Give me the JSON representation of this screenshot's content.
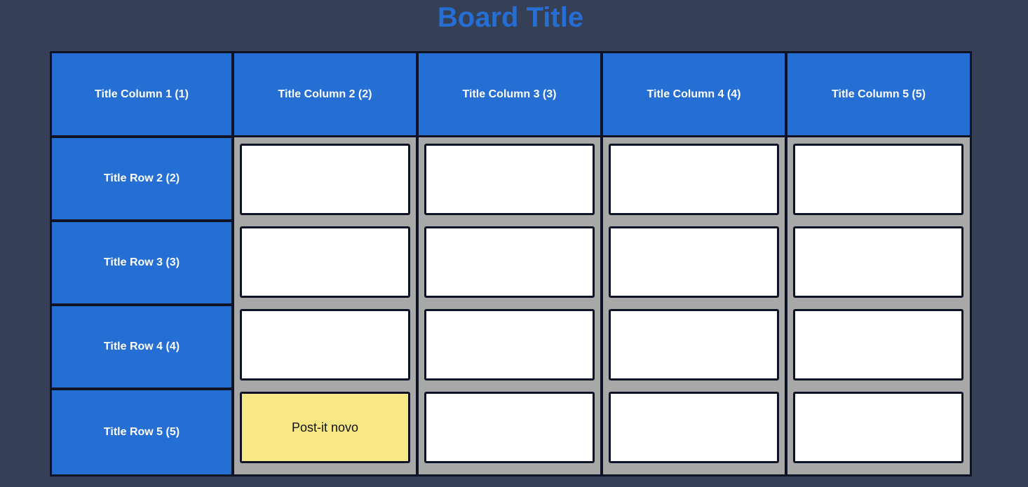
{
  "board": {
    "title": "Board Title",
    "columns": [
      {
        "label": "Title Column 1 (1)"
      },
      {
        "label": "Title Column 2 (2)"
      },
      {
        "label": "Title Column 3 (3)"
      },
      {
        "label": "Title Column 4 (4)"
      },
      {
        "label": "Title Column 5 (5)"
      }
    ],
    "rows": [
      {
        "label": "Title Row 2 (2)"
      },
      {
        "label": "Title Row 3 (3)"
      },
      {
        "label": "Title Row 4 (4)"
      },
      {
        "label": "Title Row 5 (5)"
      }
    ],
    "postits": [
      [
        "",
        "",
        "",
        ""
      ],
      [
        "",
        "",
        "",
        ""
      ],
      [
        "",
        "",
        "",
        ""
      ],
      [
        "Post-it novo",
        "",
        "",
        ""
      ]
    ]
  },
  "colors": {
    "background": "#354057",
    "accent": "#256ed3",
    "cell_background": "#a8a8a8",
    "postit_empty": "#ffffff",
    "postit_filled": "#f8e885"
  }
}
